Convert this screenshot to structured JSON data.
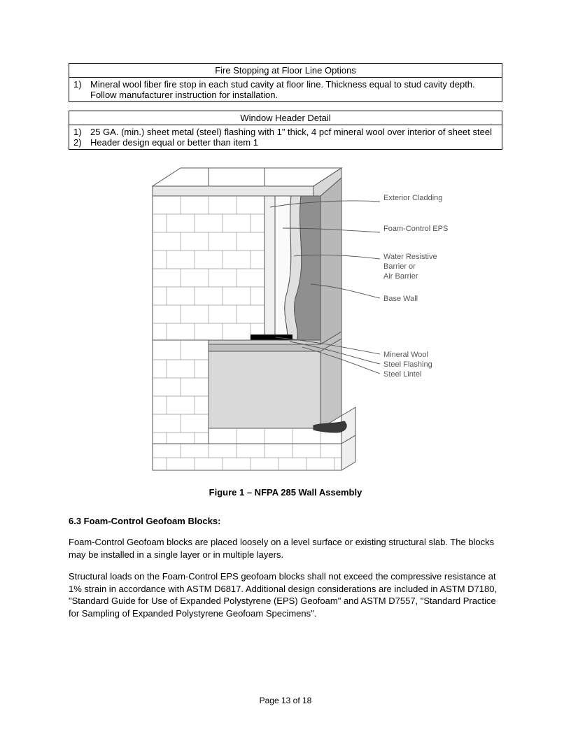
{
  "tables": {
    "fireStopping": {
      "title": "Fire Stopping at Floor Line Options",
      "items": [
        {
          "num": "1)",
          "text": "Mineral wool fiber fire stop in each stud cavity at floor line. Thickness equal to stud cavity depth. Follow manufacturer instruction for installation."
        }
      ]
    },
    "windowHeader": {
      "title": "Window Header Detail",
      "items": [
        {
          "num": "1)",
          "text": "25 GA. (min.) sheet metal (steel) flashing with 1\" thick, 4 pcf mineral wool over interior of sheet steel"
        },
        {
          "num": "2)",
          "text": "Header design equal or better than item 1"
        }
      ]
    }
  },
  "figure": {
    "caption": "Figure 1 – NFPA 285 Wall Assembly",
    "labels": {
      "exteriorCladding": "Exterior Cladding",
      "foamControlEPS": "Foam-Control EPS",
      "waterResistive1": "Water Resistive",
      "waterResistive2": "Barrier or",
      "waterResistive3": "Air Barrier",
      "baseWall": "Base Wall",
      "mineralWool": "Mineral Wool",
      "steelFlashing": "Steel Flashing",
      "steelLintel": "Steel Lintel"
    }
  },
  "section": {
    "heading": "6.3 Foam-Control Geofoam Blocks:",
    "para1": "Foam-Control Geofoam blocks are placed loosely on a level surface or existing structural slab.  The blocks may be installed in a single layer or in multiple layers.",
    "para2": "Structural loads on the Foam-Control EPS geofoam blocks shall not exceed the compressive resistance at 1% strain in accordance with ASTM D6817.  Additional design considerations are included in ASTM D7180, \"Standard Guide for Use of Expanded Polystyrene (EPS) Geofoam\" and ASTM D7557, \"Standard Practice for Sampling of Expanded Polystyrene Geofoam Specimens\"."
  },
  "footer": "Page 13 of 18"
}
